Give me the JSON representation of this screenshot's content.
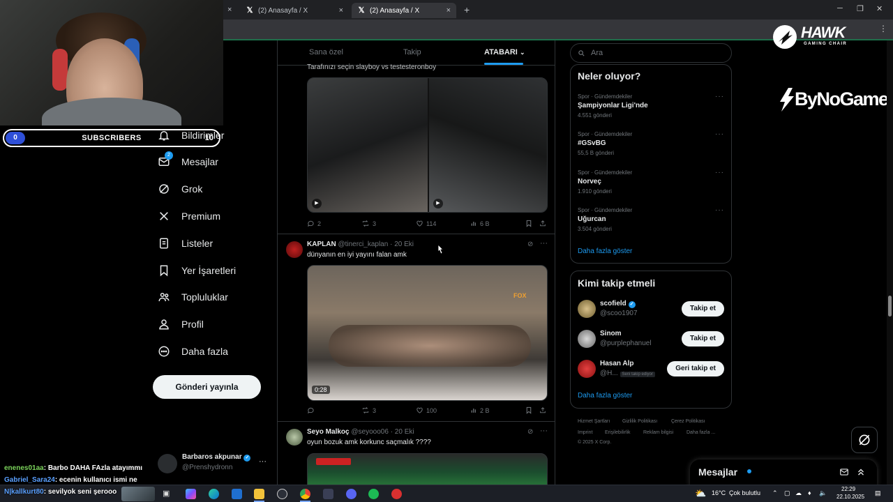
{
  "browser": {
    "tabs": [
      {
        "label": "(2) Anasayfa / X"
      },
      {
        "label": "(2) Anasayfa / X"
      }
    ],
    "new_tab": "+",
    "close": "×"
  },
  "overlay": {
    "subscribers": {
      "current": "0",
      "label": "SUBSCRIBERS",
      "goal": "10"
    },
    "chat": [
      {
        "user": "enenes01aa",
        "text": ": Barbo DAHA FAzla atayımmı"
      },
      {
        "user": "Gabriel_Sara24",
        "text": ": ecenin kullanıcı ismi ne"
      },
      {
        "user": "N|kallkurt80",
        "text": ": sevilyok seni şerooo"
      }
    ],
    "sponsors": {
      "hawk_title": "HAWK",
      "hawk_sub": "GAMING CHAIR",
      "bynogame": "ByNoGame"
    }
  },
  "nav": {
    "items": [
      {
        "label": "Bildirimler",
        "icon": "bell-icon"
      },
      {
        "label": "Mesajlar",
        "icon": "mail-icon",
        "badge": "2"
      },
      {
        "label": "Grok",
        "icon": "grok-icon"
      },
      {
        "label": "Premium",
        "icon": "x-logo-icon"
      },
      {
        "label": "Listeler",
        "icon": "list-icon"
      },
      {
        "label": "Yer İşaretleri",
        "icon": "bookmark-icon"
      },
      {
        "label": "Topluluklar",
        "icon": "people-icon"
      },
      {
        "label": "Profil",
        "icon": "person-icon"
      },
      {
        "label": "Daha fazla",
        "icon": "more-circle-icon"
      }
    ],
    "post_button": "Gönderi yayınla",
    "account": {
      "name": "Barbaros akpunar",
      "handle": "@Prenshydronn",
      "more": "···"
    }
  },
  "timeline": {
    "tabs": [
      {
        "label": "Sana özel"
      },
      {
        "label": "Takip"
      },
      {
        "label": "ATABARI"
      }
    ],
    "tweets": [
      {
        "text": "Tarafınızı seçin slayboy vs testesteronboy",
        "stats": {
          "replies": "2",
          "reposts": "3",
          "likes": "114",
          "views": "6 B"
        }
      },
      {
        "name": "KAPLAN",
        "handle": "@tinerci_kaplan",
        "date": "· 20 Eki",
        "text": "dünyanın en iyi yayını falan amk",
        "video_time": "0:28",
        "stats": {
          "replies": "",
          "reposts": "3",
          "likes": "100",
          "views": "2 B"
        }
      },
      {
        "name": "Seyo Malkoç",
        "handle": "@seyooo06",
        "date": "· 20 Eki",
        "text": "oyun bozuk amk korkunc saçmalık ????"
      }
    ]
  },
  "right": {
    "search_placeholder": "Ara",
    "trends_title": "Neler oluyor?",
    "trends": [
      {
        "category": "Spor · Gündemdekiler",
        "name": "Şampiyonlar Ligi'nde",
        "count": "4.551 gönderi"
      },
      {
        "category": "Spor · Gündemdekiler",
        "name": "#GSvBG",
        "count": "55,5 B gönderi"
      },
      {
        "category": "Spor · Gündemdekiler",
        "name": "Norveç",
        "count": "1.910 gönderi"
      },
      {
        "category": "Spor · Gündemdekiler",
        "name": "Uğurcan",
        "count": "3.504 gönderi"
      }
    ],
    "show_more": "Daha fazla göster",
    "follow_title": "Kimi takip etmeli",
    "follow": [
      {
        "name": "scofield",
        "handle": "@scoo1907",
        "button": "Takip et",
        "verified": true
      },
      {
        "name": "Sinom",
        "handle": "@purplephanuel",
        "button": "Takip et",
        "verified": false
      },
      {
        "name": "Hasan Alp",
        "handle": "@H...",
        "tag": "Seni takip ediyor",
        "button": "Geri takip et",
        "verified": false
      }
    ],
    "follow_more": "Daha fazla göster",
    "footer": [
      {
        "label": "Hizmet Şartları"
      },
      {
        "label": "Gizlilik Politikası"
      },
      {
        "label": "Çerez Politikası"
      },
      {
        "label": "Imprint"
      },
      {
        "label": "Erişilebilirlik"
      },
      {
        "label": "Reklam bilgisi"
      },
      {
        "label": "Daha fazla ..."
      }
    ],
    "copyright": "© 2025 X Corp."
  },
  "messages_drawer": {
    "title": "Mesajlar"
  },
  "taskbar": {
    "weather_temp": "16°C",
    "weather_text": "Çok bulutlu",
    "time": "22:29",
    "date": "22.10.2025"
  },
  "colors": {
    "accent": "#1d9bf0",
    "bg": "#000000",
    "border": "#2f3336",
    "muted": "#71767b"
  }
}
